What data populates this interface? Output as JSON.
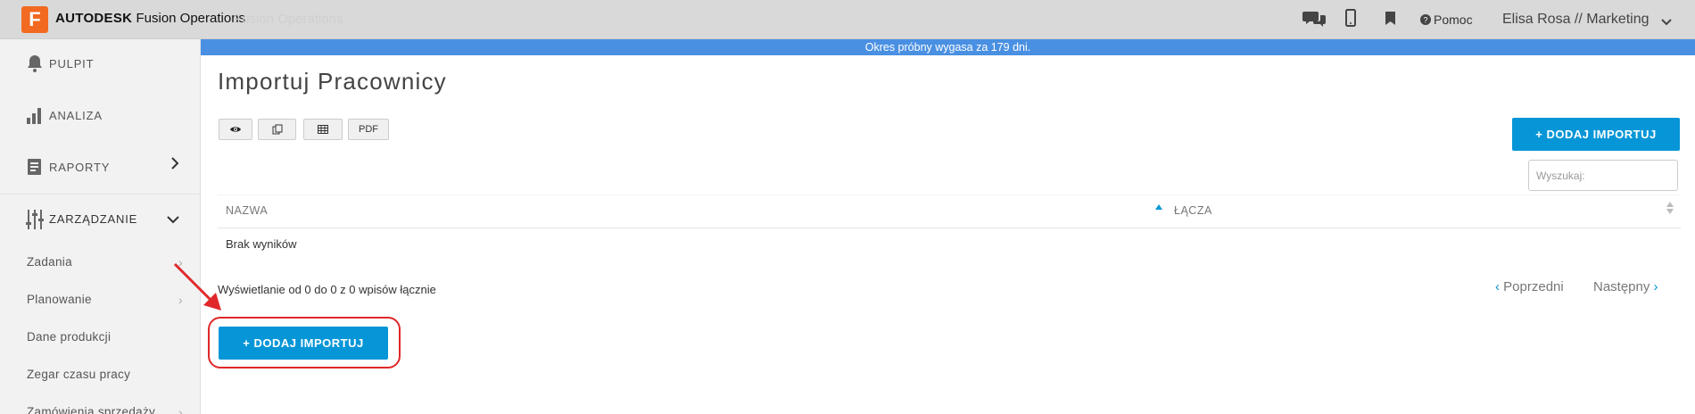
{
  "header": {
    "logo_letter": "F",
    "brand_bold": "AUTODESK",
    "brand_rest": "Fusion Operations",
    "faded_left": "Fusion Operations",
    "faded_right": "",
    "help_label": "Pomoc",
    "user_label": "Elisa Rosa // Marketing",
    "icons": [
      "chat-icon",
      "mobile-icon",
      "bookmark-icon",
      "help-circle-icon",
      "chevron-down-icon"
    ]
  },
  "banner": {
    "text": "Okres próbny wygasa za 179 dni."
  },
  "sidebar": {
    "items": [
      {
        "label": "PULPIT",
        "icon": "bell-icon"
      },
      {
        "label": "ANALIZA",
        "icon": "bar-chart-icon"
      },
      {
        "label": "RAPORTY",
        "icon": "report-icon",
        "chevron": "›"
      },
      {
        "label": "ZARZĄDZANIE",
        "icon": "sliders-icon",
        "chevron": "⌄"
      }
    ],
    "sub_items": [
      {
        "label": "Zadania",
        "chevron": "›"
      },
      {
        "label": "Planowanie",
        "chevron": "›"
      },
      {
        "label": "Dane produkcji"
      },
      {
        "label": "Zegar czasu pracy"
      },
      {
        "label": "Zamówienia sprzedaży",
        "chevron": "›"
      }
    ]
  },
  "main": {
    "title": "Importuj Pracownicy",
    "toolbar": {
      "pdf_label": "PDF"
    },
    "add_button_top": "+ DODAJ IMPORTUJ",
    "search_placeholder": "Wyszukaj:",
    "table": {
      "columns": [
        "NAZWA",
        "ŁĄCZA"
      ],
      "empty_text": "Brak wyników"
    },
    "info_text": "Wyświetlanie od 0 do 0 z 0 wpisów łącznie",
    "pager": {
      "prev_label": "Poprzedni",
      "next_label": "Następny"
    },
    "add_button_bottom": "+ DODAJ IMPORTUJ"
  },
  "colors": {
    "accent": "#0696d7",
    "banner": "#4a90e2",
    "logo": "#f26a21",
    "annotation": "#e0282a"
  }
}
